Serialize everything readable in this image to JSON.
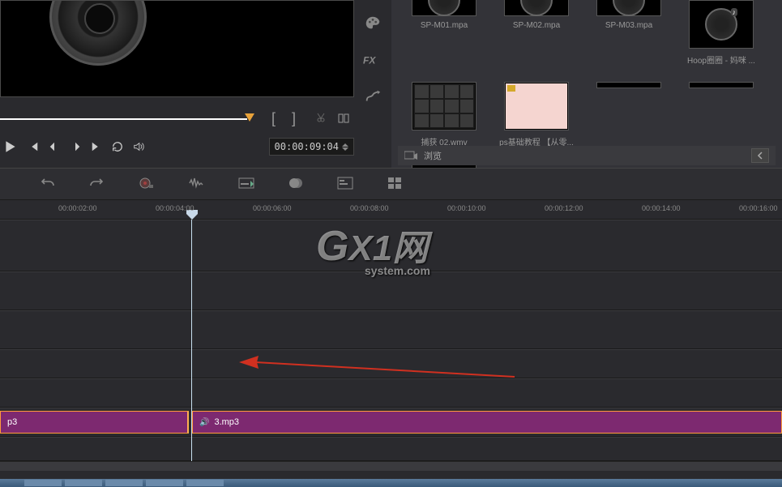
{
  "preview": {
    "timecode": "00:00:09:04"
  },
  "media": {
    "items": [
      {
        "label": "SP-M01.mpa",
        "thumb": "music"
      },
      {
        "label": "SP-M02.mpa",
        "thumb": "music"
      },
      {
        "label": "SP-M03.mpa",
        "thumb": "music"
      },
      {
        "label": "Hoop圈圈 - 妈咪 ...",
        "thumb": "music"
      },
      {
        "label": "捕获 02.wmv",
        "thumb": "grid"
      },
      {
        "label": "ps基础教程 【从零...",
        "thumb": "pink"
      }
    ],
    "browse_label": "浏览"
  },
  "ruler": {
    "ticks": [
      {
        "label": "00:00:02:00",
        "pos": 72
      },
      {
        "label": "00:00:04:00",
        "pos": 192
      },
      {
        "label": "00:00:06:00",
        "pos": 312
      },
      {
        "label": "00:00:08:00",
        "pos": 432
      },
      {
        "label": "00:00:10:00",
        "pos": 552
      },
      {
        "label": "00:00:12:00",
        "pos": 672
      },
      {
        "label": "00:00:14:00",
        "pos": 792
      },
      {
        "label": "00:00:16:00",
        "pos": 912
      }
    ]
  },
  "timeline": {
    "clip1_label": "p3",
    "clip2_label": "3.mp3"
  },
  "watermark": {
    "text1": "G",
    "text2": "X1网",
    "domain": "system.com"
  }
}
